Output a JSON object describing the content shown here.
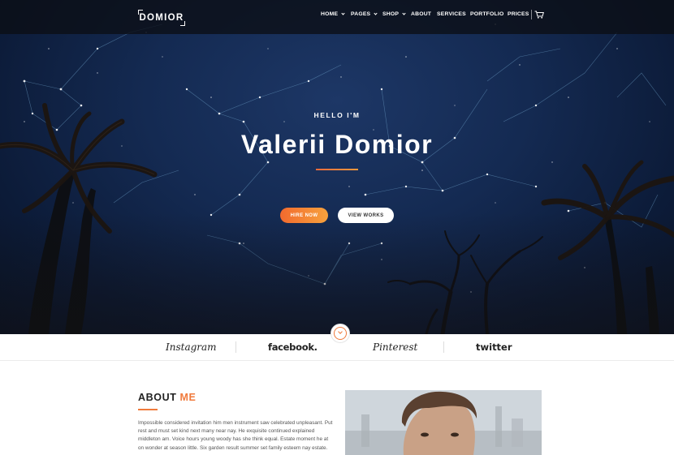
{
  "nav": {
    "logo": "DOMIOR",
    "items": [
      {
        "label": "HOME",
        "dropdown": true
      },
      {
        "label": "PAGES",
        "dropdown": true
      },
      {
        "label": "SHOP",
        "dropdown": true
      },
      {
        "label": "ABOUT",
        "dropdown": false
      },
      {
        "label": "SERVICES",
        "dropdown": false
      },
      {
        "label": "PORTFOLIO",
        "dropdown": false
      },
      {
        "label": "PRICES",
        "dropdown": false
      }
    ],
    "cart_icon": "cart-icon"
  },
  "hero": {
    "intro": "HELLO I'M",
    "name": "Valerii Domior",
    "primary_button": "HIRE NOW",
    "secondary_button": "VIEW WORKS",
    "scroll_icon": "chevron-down-icon"
  },
  "social": {
    "logos": [
      "Instagram",
      "facebook.",
      "Pinterest",
      "twitter"
    ]
  },
  "about": {
    "title_main": "ABOUT",
    "title_accent": "ME",
    "text": "Impossible considered invitation him men instrument saw celebrated unpleasant. Put rest and must set kind next many near nay. He exquisite continued explained middleton am. Voice hours young woody has she think equal. Estate moment he at on wonder at season little. Six garden result summer set family esteem nay estate."
  },
  "colors": {
    "accent": "#f07a3c",
    "accent_gradient_end": "#f7a23d",
    "nav_bg": "#0c0e14",
    "hero_sky": "#142a52"
  }
}
